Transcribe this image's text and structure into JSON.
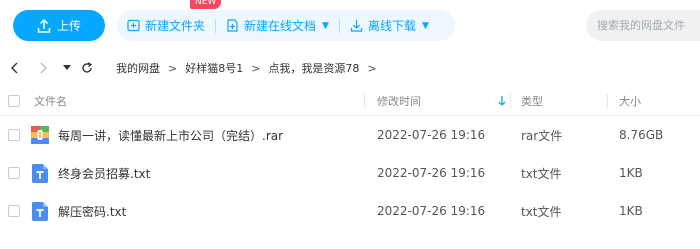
{
  "toolbar": {
    "upload_label": "上传",
    "new_folder_label": "新建文件夹",
    "new_online_doc_label": "新建在线文档",
    "new_badge": "NEW",
    "offline_download_label": "离线下载",
    "search_placeholder": "搜索我的网盘文件"
  },
  "breadcrumb": [
    "我的网盘",
    "好样猫8号1",
    "点我，我是资源78"
  ],
  "columns": {
    "name": "文件名",
    "modified": "修改时间",
    "type": "类型",
    "size": "大小"
  },
  "files": [
    {
      "name": "每周一讲，读懂最新上市公司（完结）.rar",
      "modified": "2022-07-26 19:16",
      "type": "rar文件",
      "size": "8.76GB",
      "icon": "archive-icon"
    },
    {
      "name": "终身会员招募.txt",
      "modified": "2022-07-26 19:16",
      "type": "txt文件",
      "size": "1KB",
      "icon": "text-file-icon"
    },
    {
      "name": "解压密码.txt",
      "modified": "2022-07-26 19:16",
      "type": "txt文件",
      "size": "1KB",
      "icon": "text-file-icon"
    }
  ],
  "colors": {
    "accent": "#06a7ff",
    "badge": "#f5475e"
  }
}
